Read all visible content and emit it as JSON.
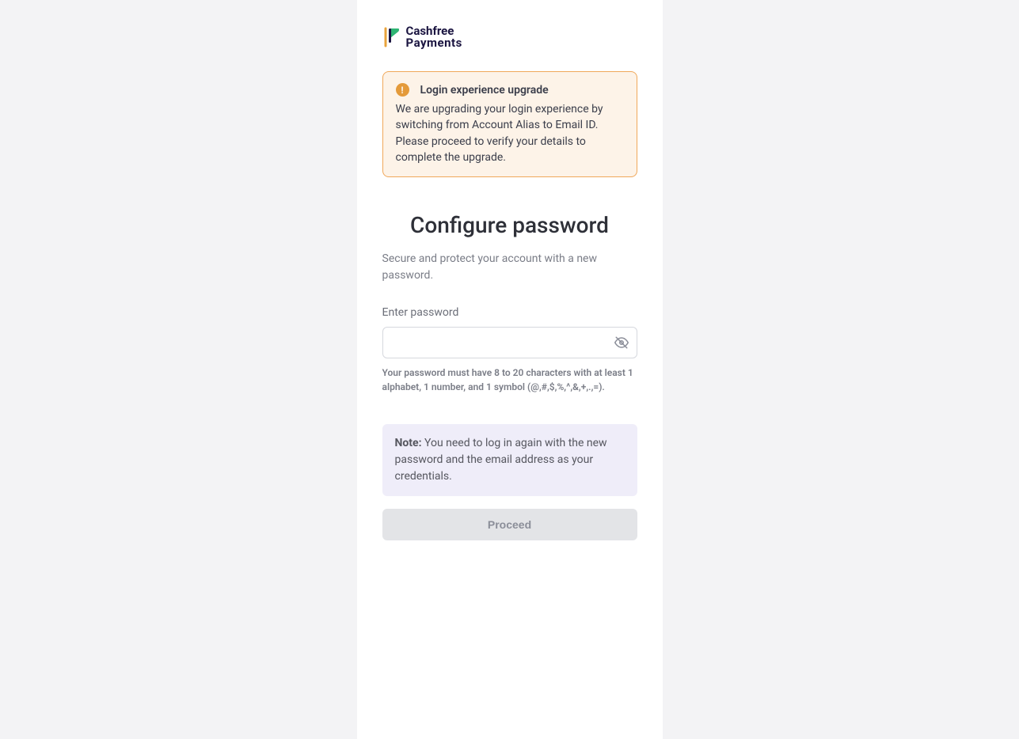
{
  "logo": {
    "line1": "Cashfree",
    "line2": "Payments"
  },
  "alert": {
    "title": "Login experience upgrade",
    "body": "We are upgrading your login experience by switching from Account Alias to Email ID. Please proceed to verify your details to complete the upgrade."
  },
  "page": {
    "title": "Configure password",
    "subtitle": "Secure and protect your account with a new password."
  },
  "field": {
    "label": "Enter password",
    "value": "",
    "hint": "Your password must have 8 to 20 characters with at least 1 alphabet, 1 number, and 1 symbol (@,#,$,%,^,&,+,.,=)."
  },
  "note": {
    "label": "Note:",
    "body": " You need to log in again with the new password and the email address as your credentials."
  },
  "button": {
    "proceed": "Proceed"
  }
}
